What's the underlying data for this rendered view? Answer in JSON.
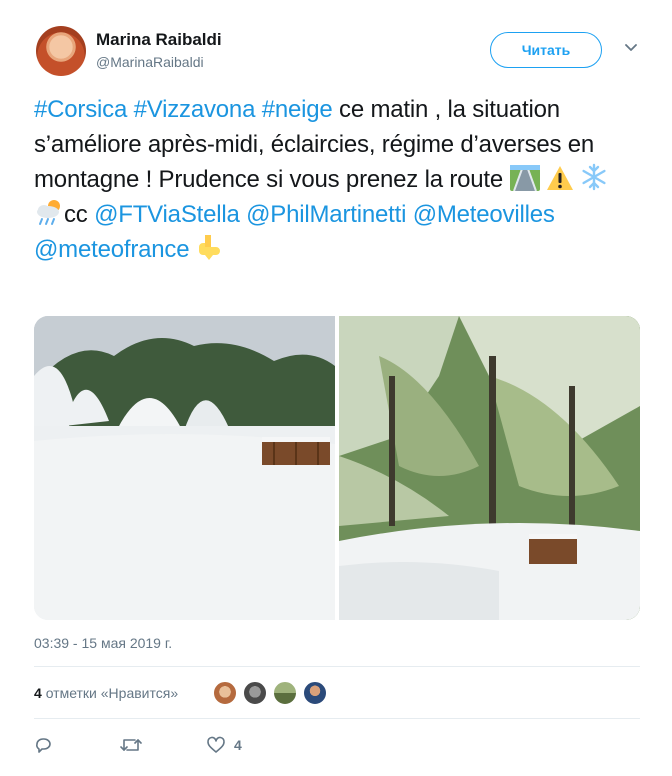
{
  "user": {
    "name": "Marina Raibaldi",
    "handle": "@MarinaRaibaldi"
  },
  "follow_label": "Читать",
  "tweet": {
    "hashtags": [
      "#Corsica",
      "#Vizzavona",
      "#neige"
    ],
    "text_1": " ce matin , la situation s’améliore après-midi, éclaircies, régime d’averses en montagne ! Prudence si vous prenez la route ",
    "emojis_1": [
      "railway-track-emoji",
      "warning-emoji",
      "snowflake-emoji",
      "cloud-rain-emoji"
    ],
    "text_2": "cc",
    "mentions": [
      "@FTViaStella",
      "@PhilMartinetti",
      "@Meteovilles",
      "@meteofrance"
    ],
    "emoji_2": "pointing-down-emoji"
  },
  "timestamp": "03:39 - 15 мая 2019 г.",
  "likes": {
    "count": "4",
    "label": "отметки «Нравится»"
  },
  "actions": {
    "reply_count": "",
    "retweet_count": "",
    "like_count": "4"
  },
  "colors": {
    "link": "#1b95e0",
    "accent": "#1da1f2",
    "muted": "#657786"
  }
}
